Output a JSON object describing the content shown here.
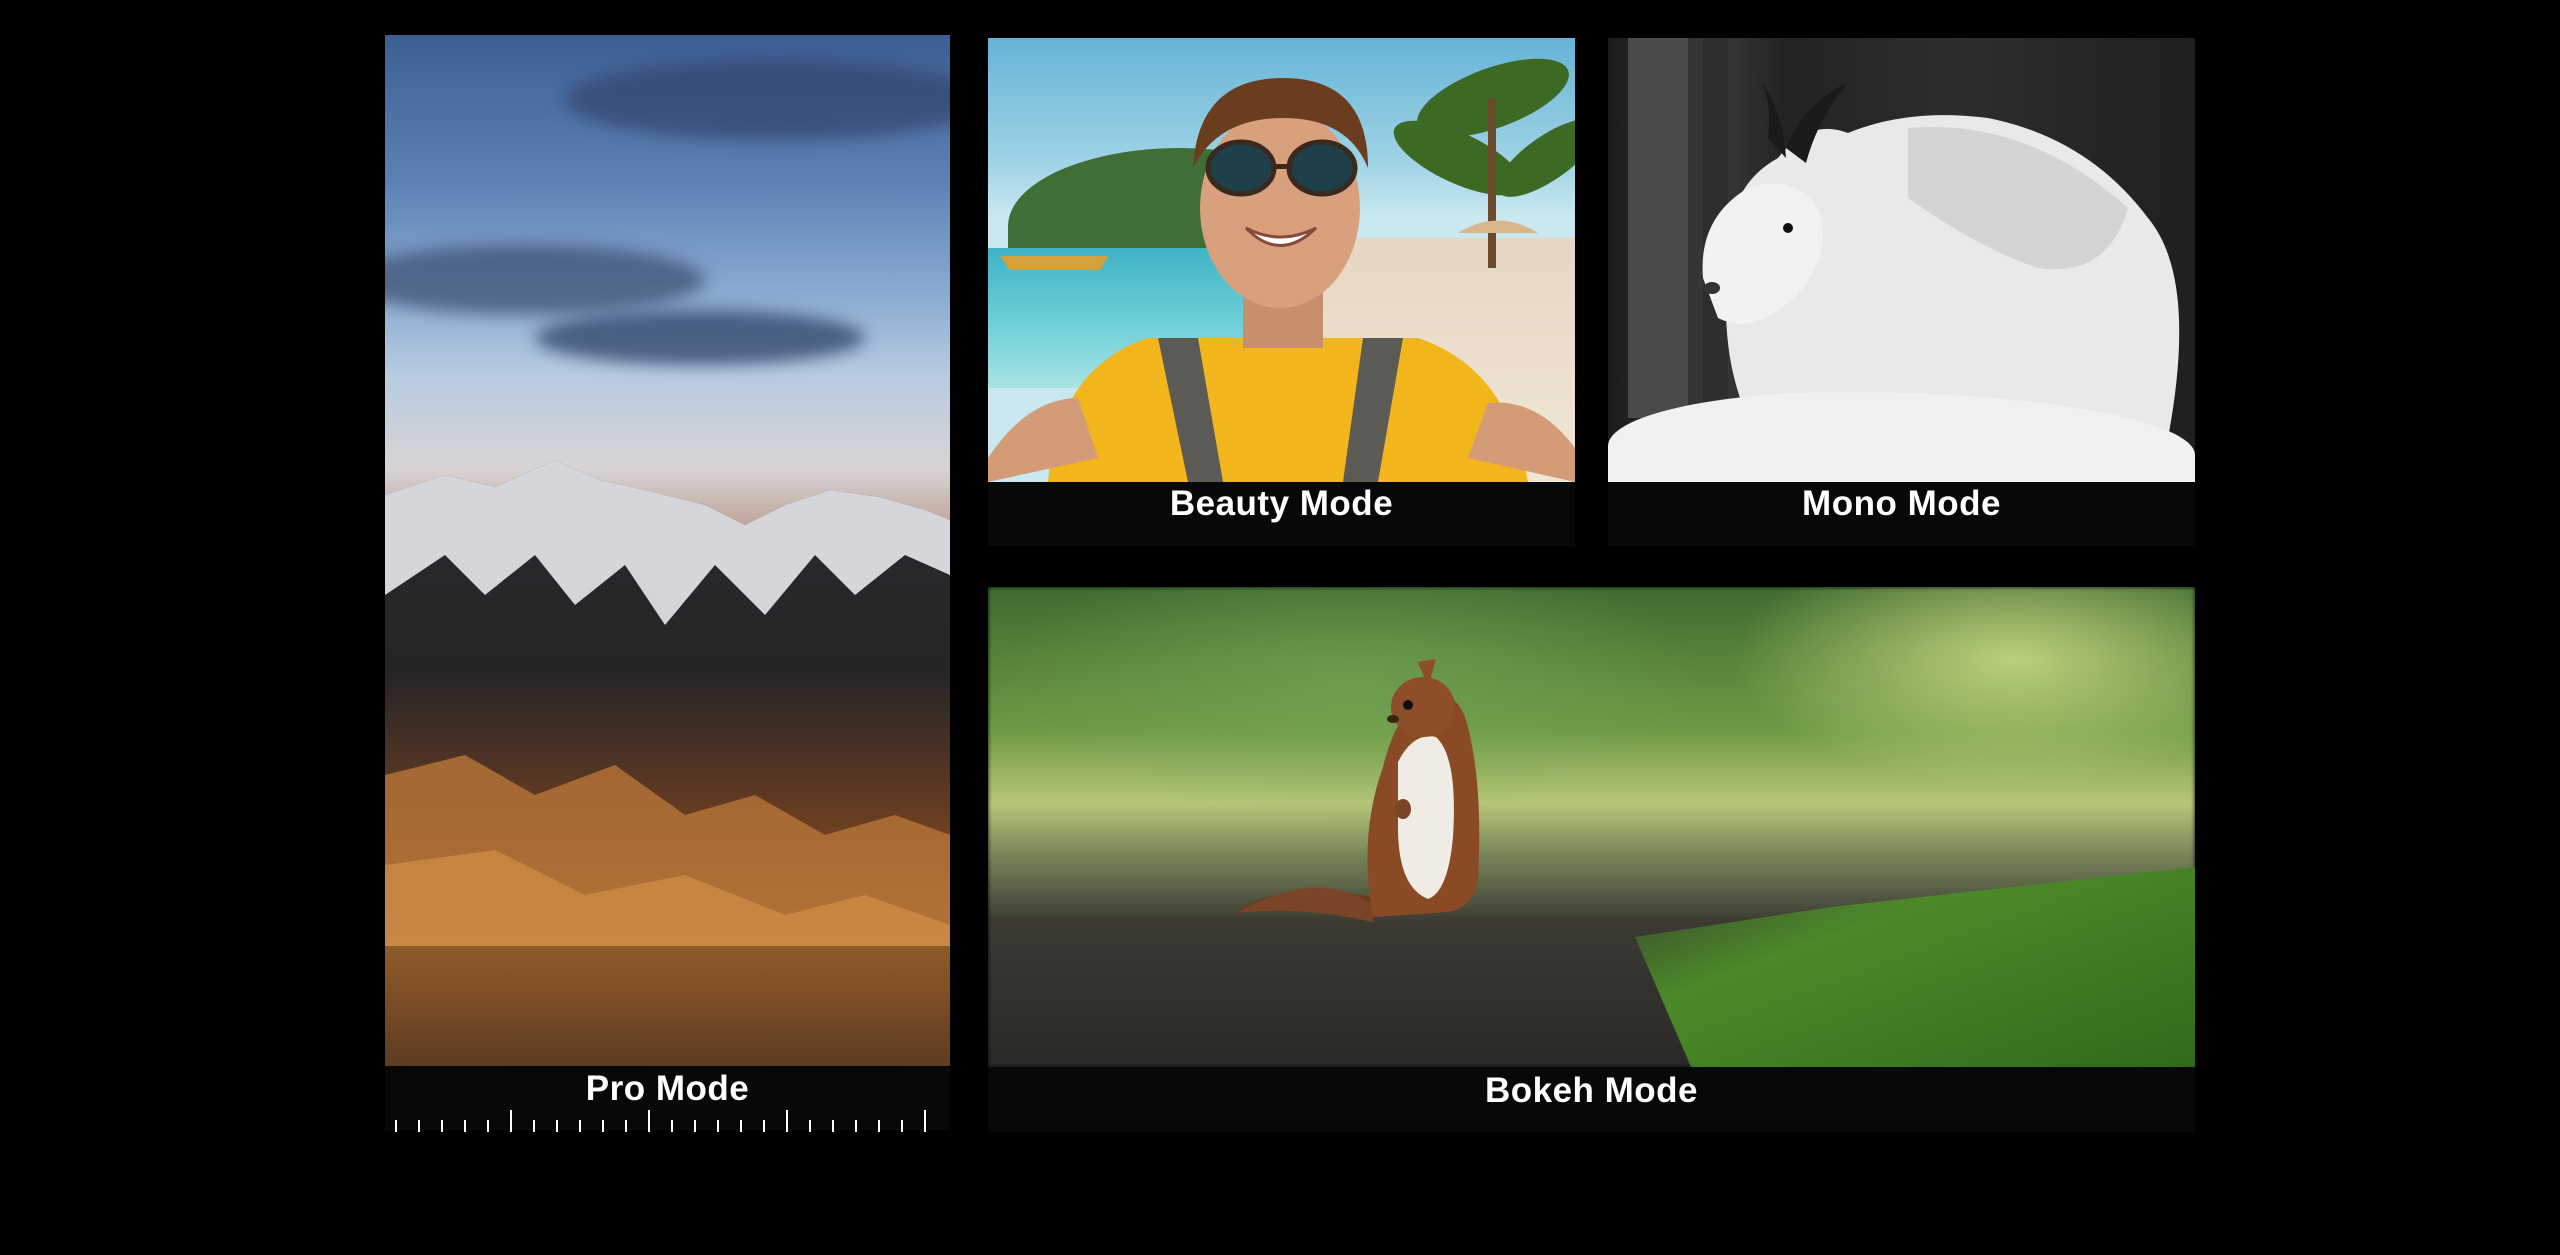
{
  "cards": [
    {
      "id": "pro",
      "label": "Pro Mode"
    },
    {
      "id": "beauty",
      "label": "Beauty Mode"
    },
    {
      "id": "mono",
      "label": "Mono Mode"
    },
    {
      "id": "bokeh",
      "label": "Bokeh Mode"
    }
  ],
  "colors": {
    "background": "#000000",
    "card_caption_bg": "#07080a",
    "label_text": "#ffffff"
  }
}
